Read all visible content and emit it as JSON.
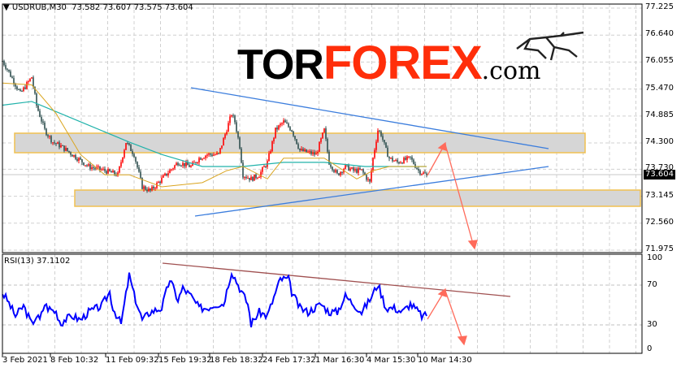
{
  "header": {
    "symbol": "USDRUB,M30",
    "ohlc": "73.582 73.607 73.575 73.604",
    "arrow": "▼"
  },
  "logo": {
    "part1": "TOR",
    "part2": "FOREX",
    "part3": ".com"
  },
  "current_price": "73.604",
  "rsi": {
    "label": "RSI(13) 37.1102"
  },
  "colors": {
    "up": "#ff0000",
    "down": "#2f4f4f",
    "ma_fast": "#daa520",
    "ma_slow": "#20b2aa",
    "rsi": "#0000ff",
    "trend": "#3b7ddd",
    "arrow": "#ff6b5b",
    "rsi_trend": "#a05050"
  },
  "chart_data": [
    {
      "type": "line",
      "title": "USDRUB,M30",
      "ylim": [
        71.975,
        77.225
      ],
      "yticks": [
        "77.225",
        "76.640",
        "76.055",
        "75.470",
        "74.885",
        "74.300",
        "73.730",
        "73.145",
        "72.560",
        "71.975"
      ],
      "xticks": [
        "3 Feb 2021",
        "8 Feb 10:32",
        "11 Feb 09:32",
        "15 Feb 19:32",
        "18 Feb 18:32",
        "24 Feb 17:32",
        "1 Mar 16:30",
        "4 Mar 15:30",
        "10 Mar 14:30"
      ],
      "series": [
        {
          "name": "close",
          "x": [
            0,
            3,
            11,
            18,
            21,
            26,
            31,
            36,
            43,
            53,
            63,
            71,
            76,
            81,
            86,
            91,
            103,
            108,
            116,
            121,
            126,
            133,
            141,
            143,
            146,
            148,
            153,
            158,
            163,
            168,
            173,
            178,
            183,
            193,
            198,
            201,
            206,
            211,
            216,
            221,
            226,
            228,
            231,
            233,
            236,
            238,
            243,
            251,
            256,
            258,
            261
          ],
          "y": [
            76.08,
            75.9,
            75.37,
            75.73,
            75.11,
            74.58,
            74.32,
            74.23,
            74.05,
            73.79,
            73.7,
            73.61,
            74.32,
            74.05,
            73.35,
            73.26,
            73.7,
            73.88,
            73.79,
            73.97,
            74.05,
            74.05,
            74.93,
            74.76,
            74.23,
            73.61,
            73.52,
            73.61,
            73.88,
            74.58,
            74.76,
            74.58,
            74.14,
            74.05,
            74.58,
            73.88,
            73.61,
            73.79,
            73.7,
            73.7,
            73.44,
            73.97,
            74.58,
            74.49,
            74.14,
            73.97,
            73.88,
            73.97,
            73.7,
            73.66,
            73.604
          ]
        },
        {
          "name": "MA fast",
          "x": [
            0,
            18,
            33,
            48,
            63,
            78,
            98,
            123,
            138,
            148,
            163,
            173,
            198,
            218,
            228,
            238,
            261
          ],
          "y": [
            75.6,
            75.56,
            74.94,
            74.05,
            73.61,
            73.61,
            73.35,
            73.44,
            73.7,
            73.79,
            73.52,
            73.97,
            73.97,
            73.52,
            73.7,
            73.79,
            73.79
          ]
        },
        {
          "name": "MA slow",
          "x": [
            0,
            18,
            48,
            78,
            98,
            123,
            148,
            173,
            198,
            223,
            238,
            261
          ],
          "y": [
            75.12,
            75.2,
            74.76,
            74.32,
            74.05,
            73.79,
            73.79,
            73.88,
            73.88,
            73.79,
            73.79,
            73.79
          ]
        }
      ],
      "zones": [
        {
          "from": 74.06,
          "to": 74.5
        },
        {
          "from": 72.98,
          "to": 73.33
        }
      ]
    },
    {
      "type": "line",
      "title": "RSI(13) 37.1102",
      "ylim": [
        0,
        100
      ],
      "yticks": [
        "100",
        "70",
        "30",
        "0"
      ],
      "series": [
        {
          "name": "RSI",
          "x": [
            0,
            3,
            8,
            13,
            18,
            21,
            23,
            26,
            28,
            33,
            36,
            38,
            43,
            48,
            53,
            61,
            66,
            68,
            73,
            78,
            81,
            86,
            91,
            98,
            103,
            108,
            111,
            116,
            121,
            126,
            131,
            136,
            141,
            146,
            151,
            153,
            158,
            163,
            171,
            176,
            178,
            183,
            188,
            196,
            201,
            206,
            211,
            216,
            221,
            226,
            231,
            236,
            241,
            246,
            251,
            256,
            258,
            261
          ],
          "y": [
            62,
            55,
            39,
            49,
            31,
            39,
            35,
            51,
            47,
            43,
            31,
            35,
            39,
            35,
            43,
            49,
            63,
            47,
            31,
            80,
            60,
            35,
            43,
            47,
            76,
            55,
            67,
            59,
            47,
            47,
            51,
            51,
            84,
            67,
            51,
            31,
            43,
            39,
            76,
            76,
            63,
            47,
            43,
            51,
            43,
            43,
            59,
            51,
            43,
            55,
            71,
            47,
            47,
            43,
            51,
            43,
            39,
            39
          ]
        }
      ],
      "levels": [
        70,
        30
      ]
    }
  ]
}
